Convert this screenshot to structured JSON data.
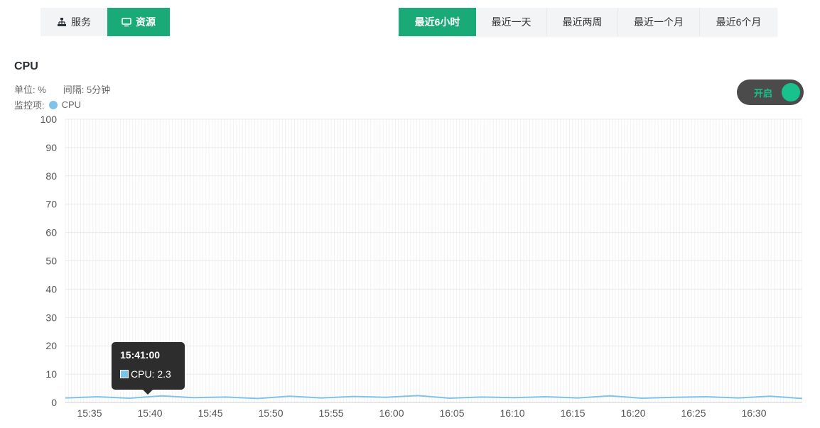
{
  "tabs": [
    {
      "label": "服务",
      "icon": "sitemap-icon",
      "active": false
    },
    {
      "label": "资源",
      "icon": "monitor-icon",
      "active": true
    }
  ],
  "time_ranges": [
    {
      "label": "最近6小时",
      "active": true
    },
    {
      "label": "最近一天",
      "active": false
    },
    {
      "label": "最近两周",
      "active": false
    },
    {
      "label": "最近一个月",
      "active": false
    },
    {
      "label": "最近6个月",
      "active": false
    }
  ],
  "chart_title": "CPU",
  "unit_label": "单位: %",
  "interval_label": "间隔: 5分钟",
  "legend_prefix": "监控项:",
  "legend_item": "CPU",
  "toggle_label": "开启",
  "colors": {
    "accent": "#19aa77",
    "series": "#7fc3ea",
    "toggle_on": "#19c28d"
  },
  "tooltip": {
    "time": "15:41:00",
    "text": "CPU: 2.3"
  },
  "chart_data": {
    "type": "line",
    "title": "CPU",
    "series": [
      {
        "name": "CPU",
        "values": [
          1.6,
          2.0,
          1.5,
          2.3,
          1.7,
          1.9,
          1.4,
          2.2,
          1.6,
          2.1,
          1.8,
          2.4,
          1.5,
          1.9,
          1.7,
          2.0,
          1.6,
          2.3,
          1.5,
          1.8,
          2.0,
          1.6,
          2.2,
          1.4
        ]
      }
    ],
    "x_start": "15:33",
    "x_end": "16:34",
    "x_ticks": [
      "15:35",
      "15:40",
      "15:45",
      "15:50",
      "15:55",
      "16:00",
      "16:05",
      "16:10",
      "16:15",
      "16:20",
      "16:25",
      "16:30"
    ],
    "y_ticks": [
      "0",
      "10",
      "20",
      "30",
      "40",
      "50",
      "60",
      "70",
      "80",
      "90",
      "100"
    ],
    "ylim": [
      0,
      100
    ],
    "grid": true
  }
}
